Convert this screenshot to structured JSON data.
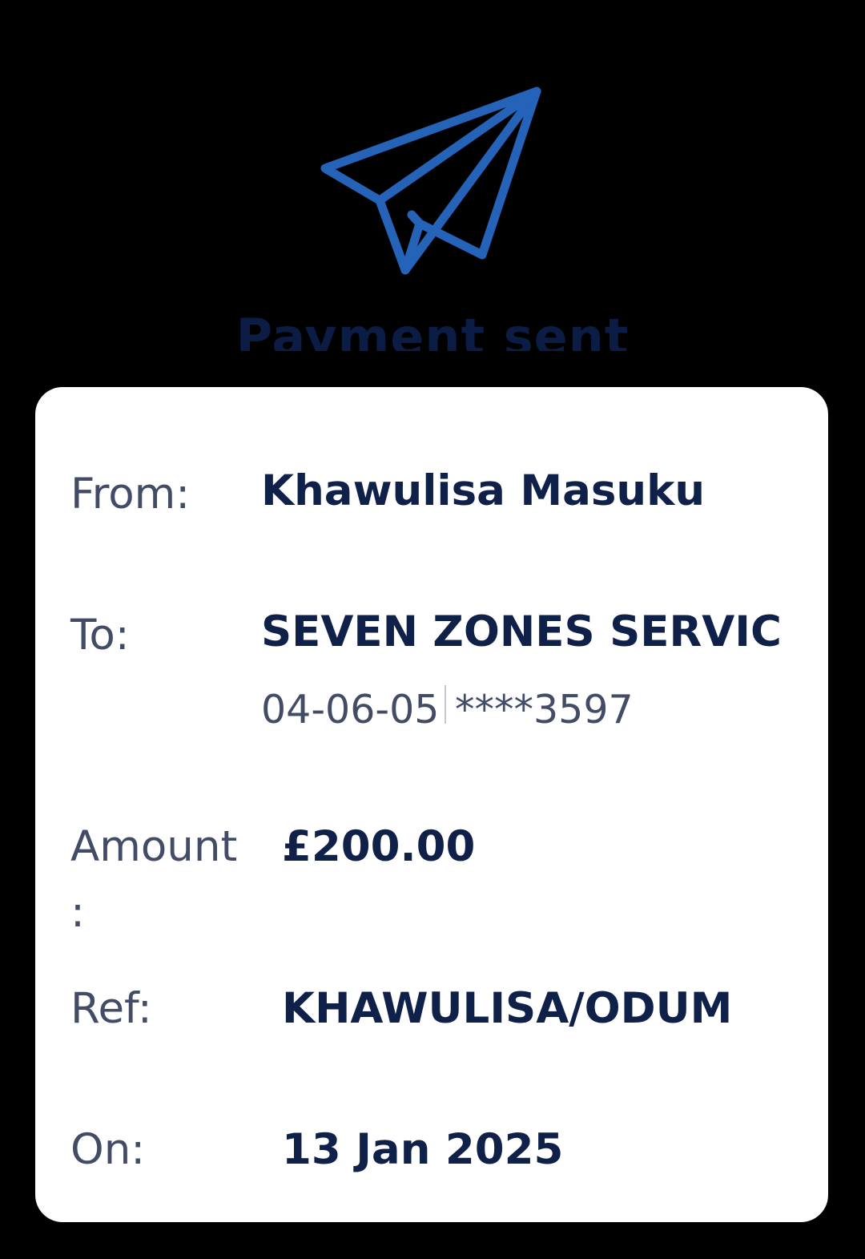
{
  "header": {
    "icon": "paper-plane-icon",
    "title": "Payment sent"
  },
  "details": {
    "from_label": "From:",
    "from_value": "Khawulisa Masuku",
    "to_label": "To:",
    "to_value": "SEVEN ZONES SERVIC",
    "to_sort_code": "04-06-05",
    "to_account": "****3597",
    "amount_label": "Amount",
    "amount_colon": ":",
    "amount_value": "£200.00",
    "ref_label": "Ref:",
    "ref_value": "KHAWULISA/ODUM",
    "on_label": "On:",
    "on_value": "13 Jan 2025"
  },
  "colors": {
    "background": "#000000",
    "card": "#ffffff",
    "accent_blue": "#2563b8",
    "value_text": "#0f2049",
    "label_text": "#424c66"
  }
}
